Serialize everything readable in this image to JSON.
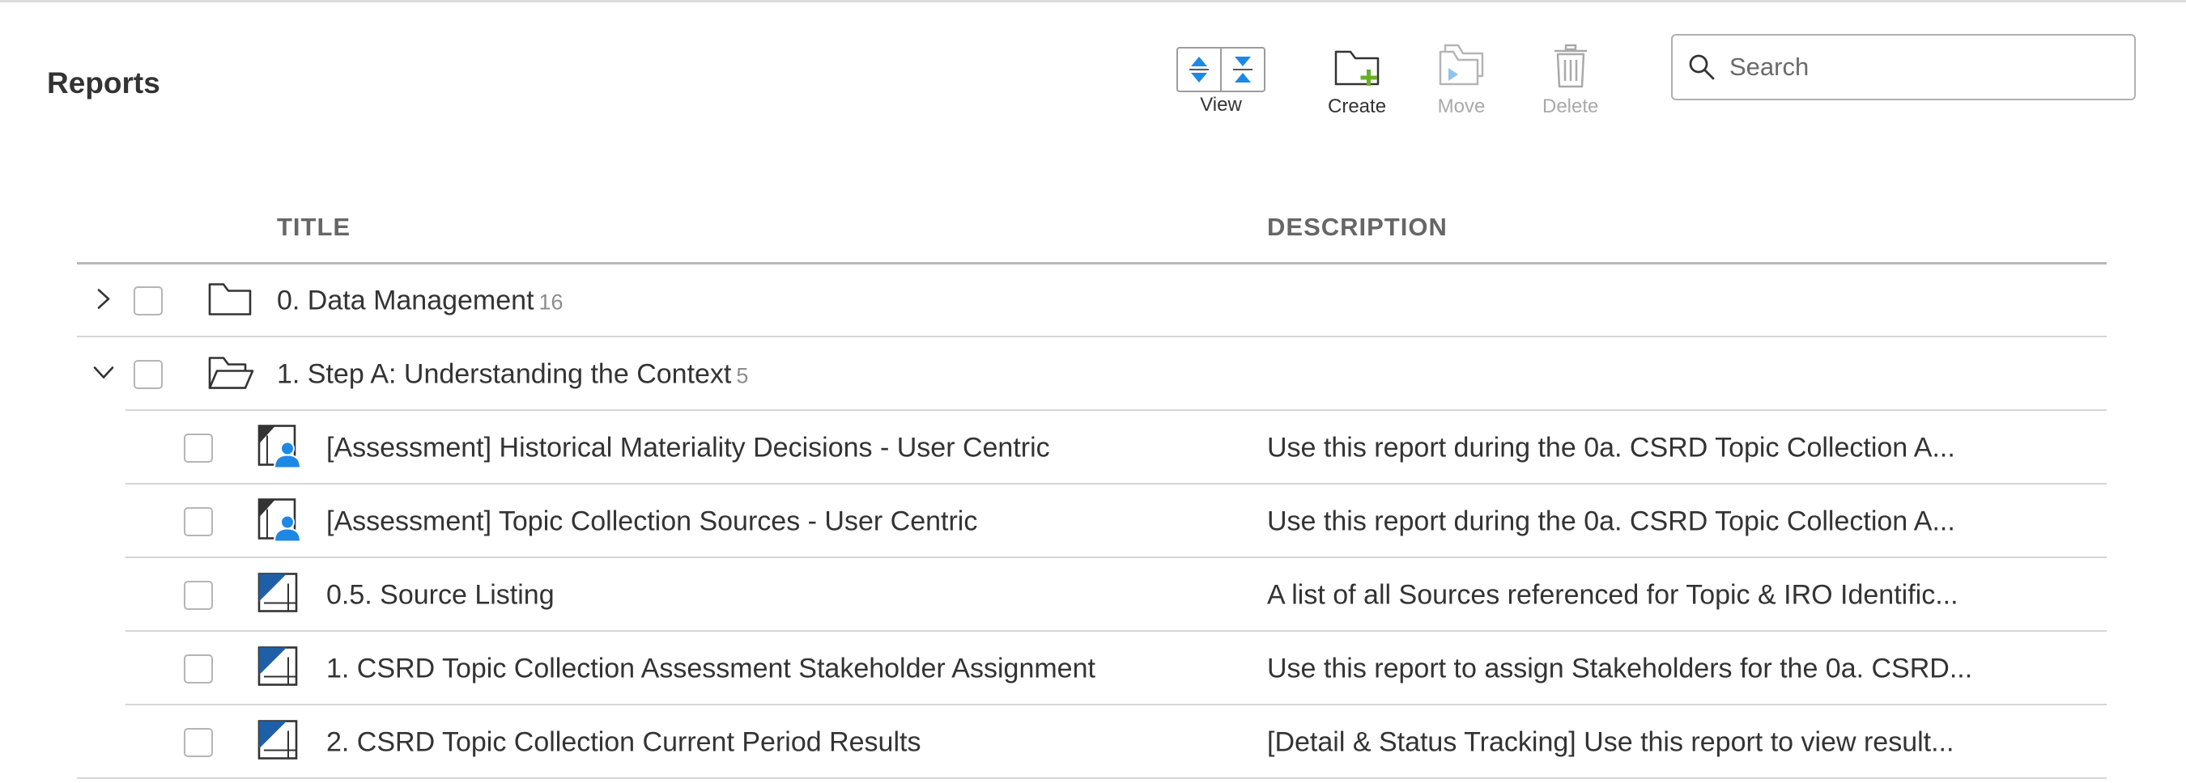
{
  "page": {
    "title": "Reports"
  },
  "toolbar": {
    "view_label": "View",
    "create_label": "Create",
    "move_label": "Move",
    "delete_label": "Delete"
  },
  "search": {
    "placeholder": "Search",
    "value": ""
  },
  "table": {
    "columns": {
      "title": "TITLE",
      "description": "DESCRIPTION"
    },
    "folders": [
      {
        "name": "0. Data Management",
        "count": "16",
        "expanded": false
      },
      {
        "name": "1. Step A: Understanding the Context",
        "count": "5",
        "expanded": true
      }
    ],
    "reports": [
      {
        "title": "[Assessment] Historical Materiality Decisions - User Centric",
        "description": "Use this report during the 0a. CSRD Topic Collection A...",
        "icon": "user-report-icon"
      },
      {
        "title": "[Assessment] Topic Collection Sources - User Centric",
        "description": "Use this report during the 0a. CSRD Topic Collection A...",
        "icon": "user-report-icon"
      },
      {
        "title": "0.5. Source Listing",
        "description": "A list of all Sources referenced for Topic & IRO Identific...",
        "icon": "report-icon"
      },
      {
        "title": "1. CSRD Topic Collection Assessment Stakeholder Assignment",
        "description": "Use this report to assign Stakeholders for the 0a. CSRD...",
        "icon": "report-icon"
      },
      {
        "title": "2. CSRD Topic Collection Current Period Results",
        "description": "[Detail & Status Tracking] Use this report to view result...",
        "icon": "report-icon"
      }
    ]
  },
  "colors": {
    "accent_blue": "#1e88e5",
    "create_plus_green": "#6ab023",
    "disabled_gray": "#a9a9a9",
    "text": "#333333"
  }
}
